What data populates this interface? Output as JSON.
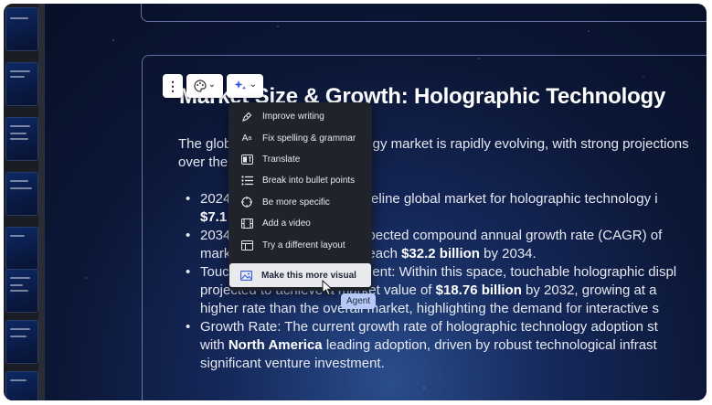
{
  "slide": {
    "title": "Market Size & Growth: Holographic Technology",
    "intro_line1": "The global holographic technology market is rapidly evolving, with strong projections",
    "intro_line2": "over the coming decade.",
    "bullets": [
      {
        "pre": "2024 Market Value: The baseline global market for holographic technology i",
        "bold": "",
        "post": ""
      },
      {
        "pre": "",
        "bold": "$7.1 billion",
        "post": ""
      },
      {
        "pre": "2034 Projection: With an expected compound annual growth rate (CAGR) of",
        "bold": "",
        "post": ""
      },
      {
        "pre": "market size is projected to reach ",
        "bold": "$32.2 billion",
        "post": " by 2034."
      },
      {
        "pre": "Touchable Holograms Segment: Within this space, touchable holographic displ",
        "bold": "",
        "post": ""
      },
      {
        "pre": "projected to achieve a market value of ",
        "bold": "$18.76 billion",
        "post": " by 2032, growing at a"
      },
      {
        "pre": "higher rate than the overall market, highlighting the demand for interactive s",
        "bold": "",
        "post": ""
      },
      {
        "pre": "Growth Rate: The current growth rate of holographic technology adoption st",
        "bold": "",
        "post": ""
      },
      {
        "pre": "with ",
        "bold": "North America",
        "post": " leading adoption, driven by robust technological infrast"
      },
      {
        "pre": "significant venture investment.",
        "bold": "",
        "post": ""
      }
    ]
  },
  "toolbar": {
    "more_icon": "⋮",
    "palette_icon": "palette-icon",
    "ai_icon": "sparkle-icon",
    "chevron": "⌄"
  },
  "ai_menu": {
    "items": [
      {
        "label": "Improve writing",
        "icon": "pen-nib-icon"
      },
      {
        "label": "Fix spelling & grammar",
        "icon": "spellcheck-icon"
      },
      {
        "label": "Translate",
        "icon": "translate-icon"
      },
      {
        "label": "Break into bullet points",
        "icon": "list-icon"
      },
      {
        "label": "Be more specific",
        "icon": "target-icon"
      },
      {
        "label": "Add a video",
        "icon": "film-icon"
      },
      {
        "label": "Try a different layout",
        "icon": "layout-icon"
      }
    ],
    "highlighted": {
      "label": "Make this more visual",
      "icon": "image-icon"
    }
  },
  "cursor_tooltip": "Agent",
  "colors": {
    "accent": "#3b5bdb",
    "menu_bg": "#20232b",
    "slide_bg": "#0b1736"
  }
}
